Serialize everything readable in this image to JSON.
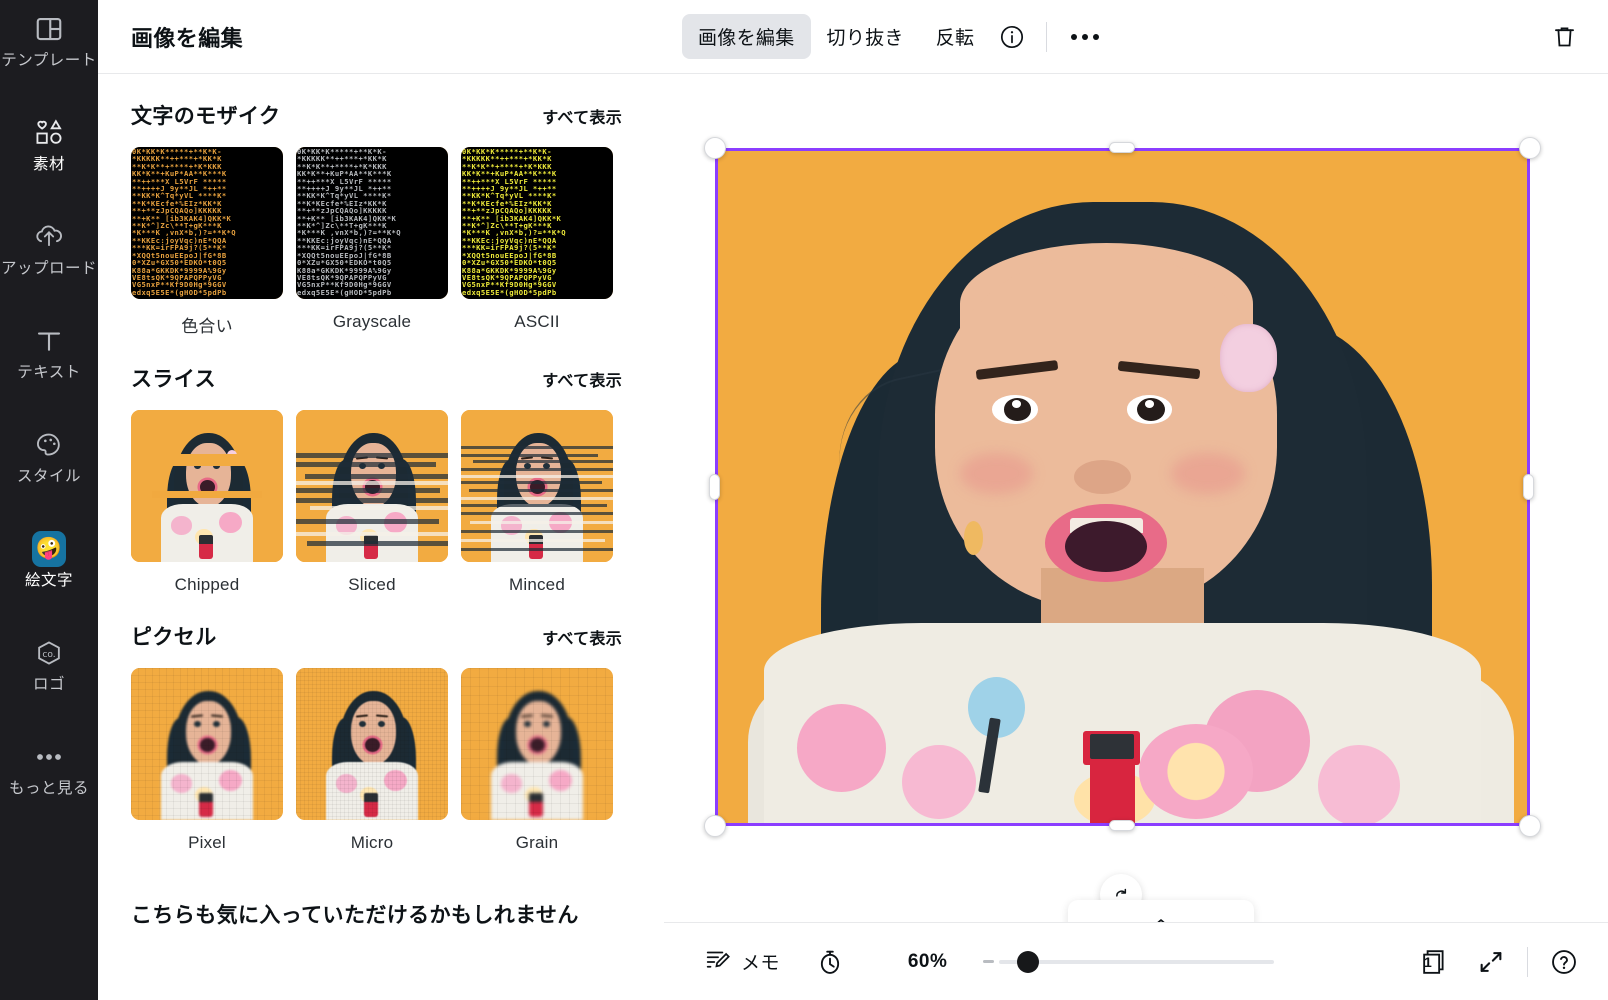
{
  "rail": {
    "items": [
      {
        "label": "テンプレート",
        "icon": "template-icon",
        "active": false
      },
      {
        "label": "素材",
        "icon": "elements-icon",
        "active": true
      },
      {
        "label": "アップロード",
        "icon": "upload-icon",
        "active": false
      },
      {
        "label": "テキスト",
        "icon": "text-icon",
        "active": false
      },
      {
        "label": "スタイル",
        "icon": "styles-icon",
        "active": false
      },
      {
        "label": "絵文字",
        "icon": "emoji-icon",
        "active": true,
        "glyph": "🤪"
      },
      {
        "label": "ロゴ",
        "icon": "logo-icon",
        "active": false
      },
      {
        "label": "もっと見る",
        "icon": "more-dots-icon",
        "active": false
      }
    ]
  },
  "panel": {
    "title": "画像を編集",
    "see_all_label": "すべて表示",
    "footer_title": "こちらも気に入っていただけるかもしれません",
    "sections": [
      {
        "title": "文字のモザイク",
        "see_all": "すべて表示",
        "items": [
          {
            "label": "色合い",
            "style": "tint"
          },
          {
            "label": "Grayscale",
            "style": "gray"
          },
          {
            "label": "ASCII",
            "style": "yel"
          }
        ]
      },
      {
        "title": "スライス",
        "see_all": "すべて表示",
        "items": [
          {
            "label": "Chipped",
            "style": "chipped"
          },
          {
            "label": "Sliced",
            "style": "sliced"
          },
          {
            "label": "Minced",
            "style": "minced"
          }
        ]
      },
      {
        "title": "ピクセル",
        "see_all": "すべて表示",
        "items": [
          {
            "label": "Pixel",
            "style": "pixel"
          },
          {
            "label": "Micro",
            "style": "micro"
          },
          {
            "label": "Grain",
            "style": "grain"
          }
        ]
      }
    ],
    "ascii_art": "0K*KK*K*****+**K*K-\n*KKKKK**++***+*KK*K\n**K*K**+****+*K*KKK\nKK*K**+KuP*AA**K***K\n**++***X L5VrF *****\n**++++J 9y**JL *++**\n**KK*K^Tq*yVL ****K*\n**K*KEcfe*%EIz*KK*K\n**+**zJpCQAQo]KKKKK\n**+K** [ib3KAK4]QKK*K\n**K*^]Zc\\**T+gK***K\n*K***K ,vnX*b,)?=**K*Q\n**KKEc:joyVqc)nE*QQA\n***KK=irFPA9j?(5**K*\n*XQQt5nouEEpoJ|fG*8B\n0*XZu*GX50*EDKO*t0Q5\nK88a*GKKDK*9999A%9Gy\nVE8tsQK*9QPAPQPPyVG\nVG5nxP**Kf9D0Hg*9GGV\nedxq5E5E*(gHOD*5pdPb"
  },
  "toolbar": {
    "edit_image_label": "画像を編集",
    "crop_label": "切り抜き",
    "flip_label": "反転",
    "info_icon": "info-icon",
    "more_icon": "more-options-icon",
    "delete_icon": "trash-icon"
  },
  "bottombar": {
    "notes_label": "メモ",
    "notes_icon": "notes-edit-icon",
    "timer_icon": "timer-icon",
    "zoom_value": "60%",
    "zoom_percent": 60,
    "pages_icon": "pages-icon",
    "page_count": "1",
    "fullscreen_icon": "fullscreen-icon",
    "help_icon": "help-icon",
    "rotate_icon": "rotate-icon",
    "collapse_icon": "chevron-up-icon"
  },
  "colors": {
    "accent_purple": "#8b3dff",
    "canvas_orange": "#f2ab41",
    "rail_bg": "#1c1c20",
    "selected_tab_bg": "#e3e5e9"
  }
}
